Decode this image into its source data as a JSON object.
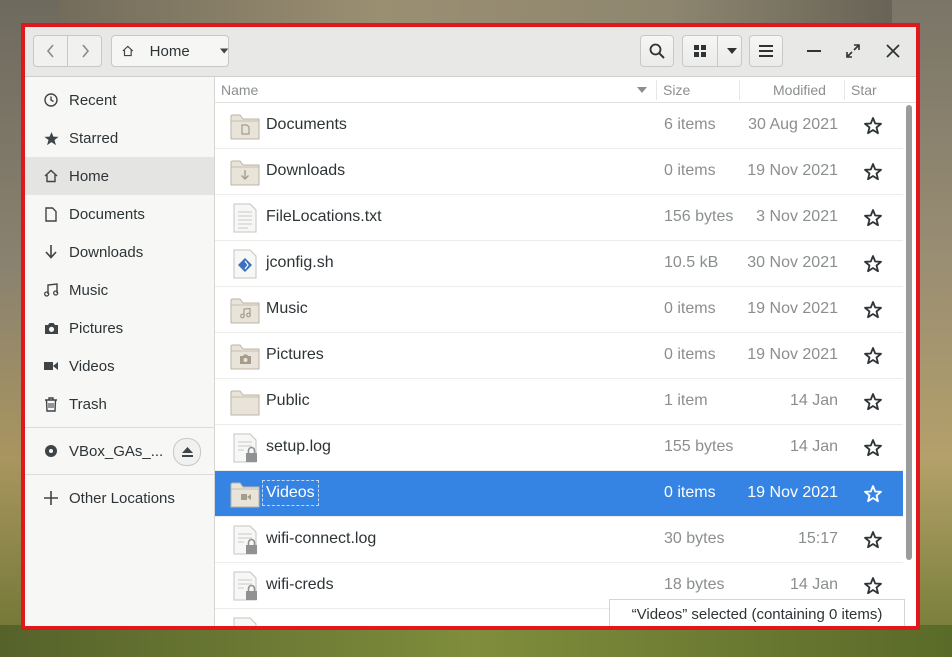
{
  "window": {
    "path_label": "Home"
  },
  "sidebar": {
    "items": [
      {
        "label": "Recent",
        "icon": "clock-icon"
      },
      {
        "label": "Starred",
        "icon": "star-icon"
      },
      {
        "label": "Home",
        "icon": "home-icon",
        "active": true
      },
      {
        "label": "Documents",
        "icon": "document-icon"
      },
      {
        "label": "Downloads",
        "icon": "download-icon"
      },
      {
        "label": "Music",
        "icon": "music-icon"
      },
      {
        "label": "Pictures",
        "icon": "camera-icon"
      },
      {
        "label": "Videos",
        "icon": "video-icon"
      },
      {
        "label": "Trash",
        "icon": "trash-icon"
      }
    ],
    "device": {
      "label": "VBox_GAs_...",
      "icon": "disc-icon"
    },
    "other": {
      "label": "Other Locations",
      "icon": "plus-icon"
    }
  },
  "columns": {
    "name": "Name",
    "size": "Size",
    "modified": "Modified",
    "star": "Star"
  },
  "files": [
    {
      "name": "Documents",
      "size": "6 items",
      "modified": "30 Aug 2021",
      "type": "folder-documents"
    },
    {
      "name": "Downloads",
      "size": "0 items",
      "modified": "19 Nov 2021",
      "type": "folder-downloads"
    },
    {
      "name": "FileLocations.txt",
      "size": "156 bytes",
      "modified": "3 Nov 2021",
      "type": "text"
    },
    {
      "name": "jconfig.sh",
      "size": "10.5 kB",
      "modified": "30 Nov 2021",
      "type": "script"
    },
    {
      "name": "Music",
      "size": "0 items",
      "modified": "19 Nov 2021",
      "type": "folder-music"
    },
    {
      "name": "Pictures",
      "size": "0 items",
      "modified": "19 Nov 2021",
      "type": "folder-pictures"
    },
    {
      "name": "Public",
      "size": "1 item",
      "modified": "14 Jan",
      "type": "folder"
    },
    {
      "name": "setup.log",
      "size": "155 bytes",
      "modified": "14 Jan",
      "type": "locked-text"
    },
    {
      "name": "Videos",
      "size": "0 items",
      "modified": "19 Nov 2021",
      "type": "folder-videos",
      "selected": true
    },
    {
      "name": "wifi-connect.log",
      "size": "30 bytes",
      "modified": "15:17",
      "type": "locked-text"
    },
    {
      "name": "wifi-creds",
      "size": "18 bytes",
      "modified": "14 Jan",
      "type": "locked-text"
    }
  ],
  "status": "“Videos” selected (containing 0 items)",
  "colors": {
    "selection": "#3584e4",
    "border": "#e0181b"
  }
}
